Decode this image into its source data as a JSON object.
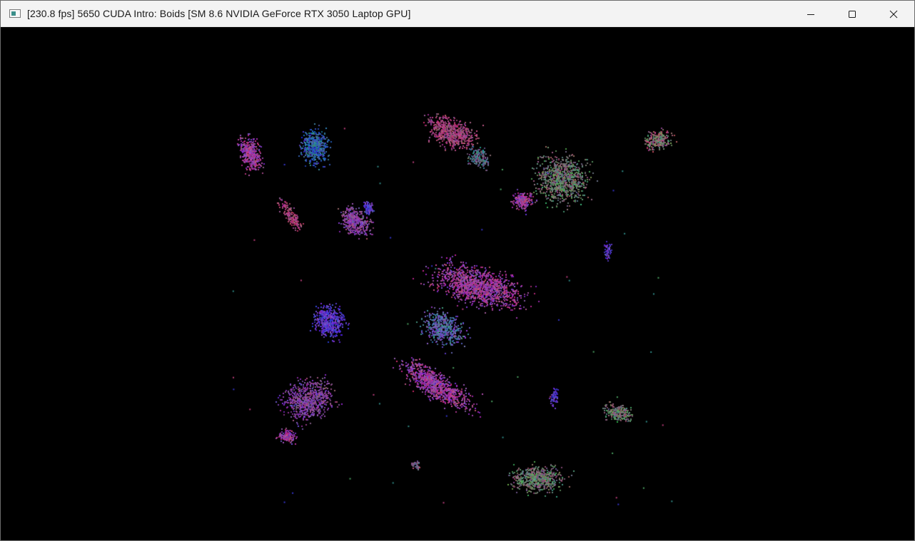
{
  "window": {
    "title": "[230.8 fps] 5650 CUDA Intro: Boids [SM 8.6 NVIDIA GeForce RTX 3050 Laptop GPU]",
    "icon": "app-window-icon",
    "controls": [
      {
        "name": "minimize",
        "icon": "minimize-icon"
      },
      {
        "name": "maximize",
        "icon": "maximize-icon"
      },
      {
        "name": "close",
        "icon": "close-icon"
      }
    ]
  },
  "viewport": {
    "background": "#000000",
    "content": "boids simulation point cloud"
  },
  "colors": {
    "titlebar_bg": "#f3f3f3",
    "title_text": "#1a1a1a",
    "magenta": "#b83c78",
    "teal": "#2f8a86",
    "blue": "#3434c8",
    "purple": "#7a3cc0",
    "mauve": "#8a4a78",
    "green": "#4aa060"
  }
}
